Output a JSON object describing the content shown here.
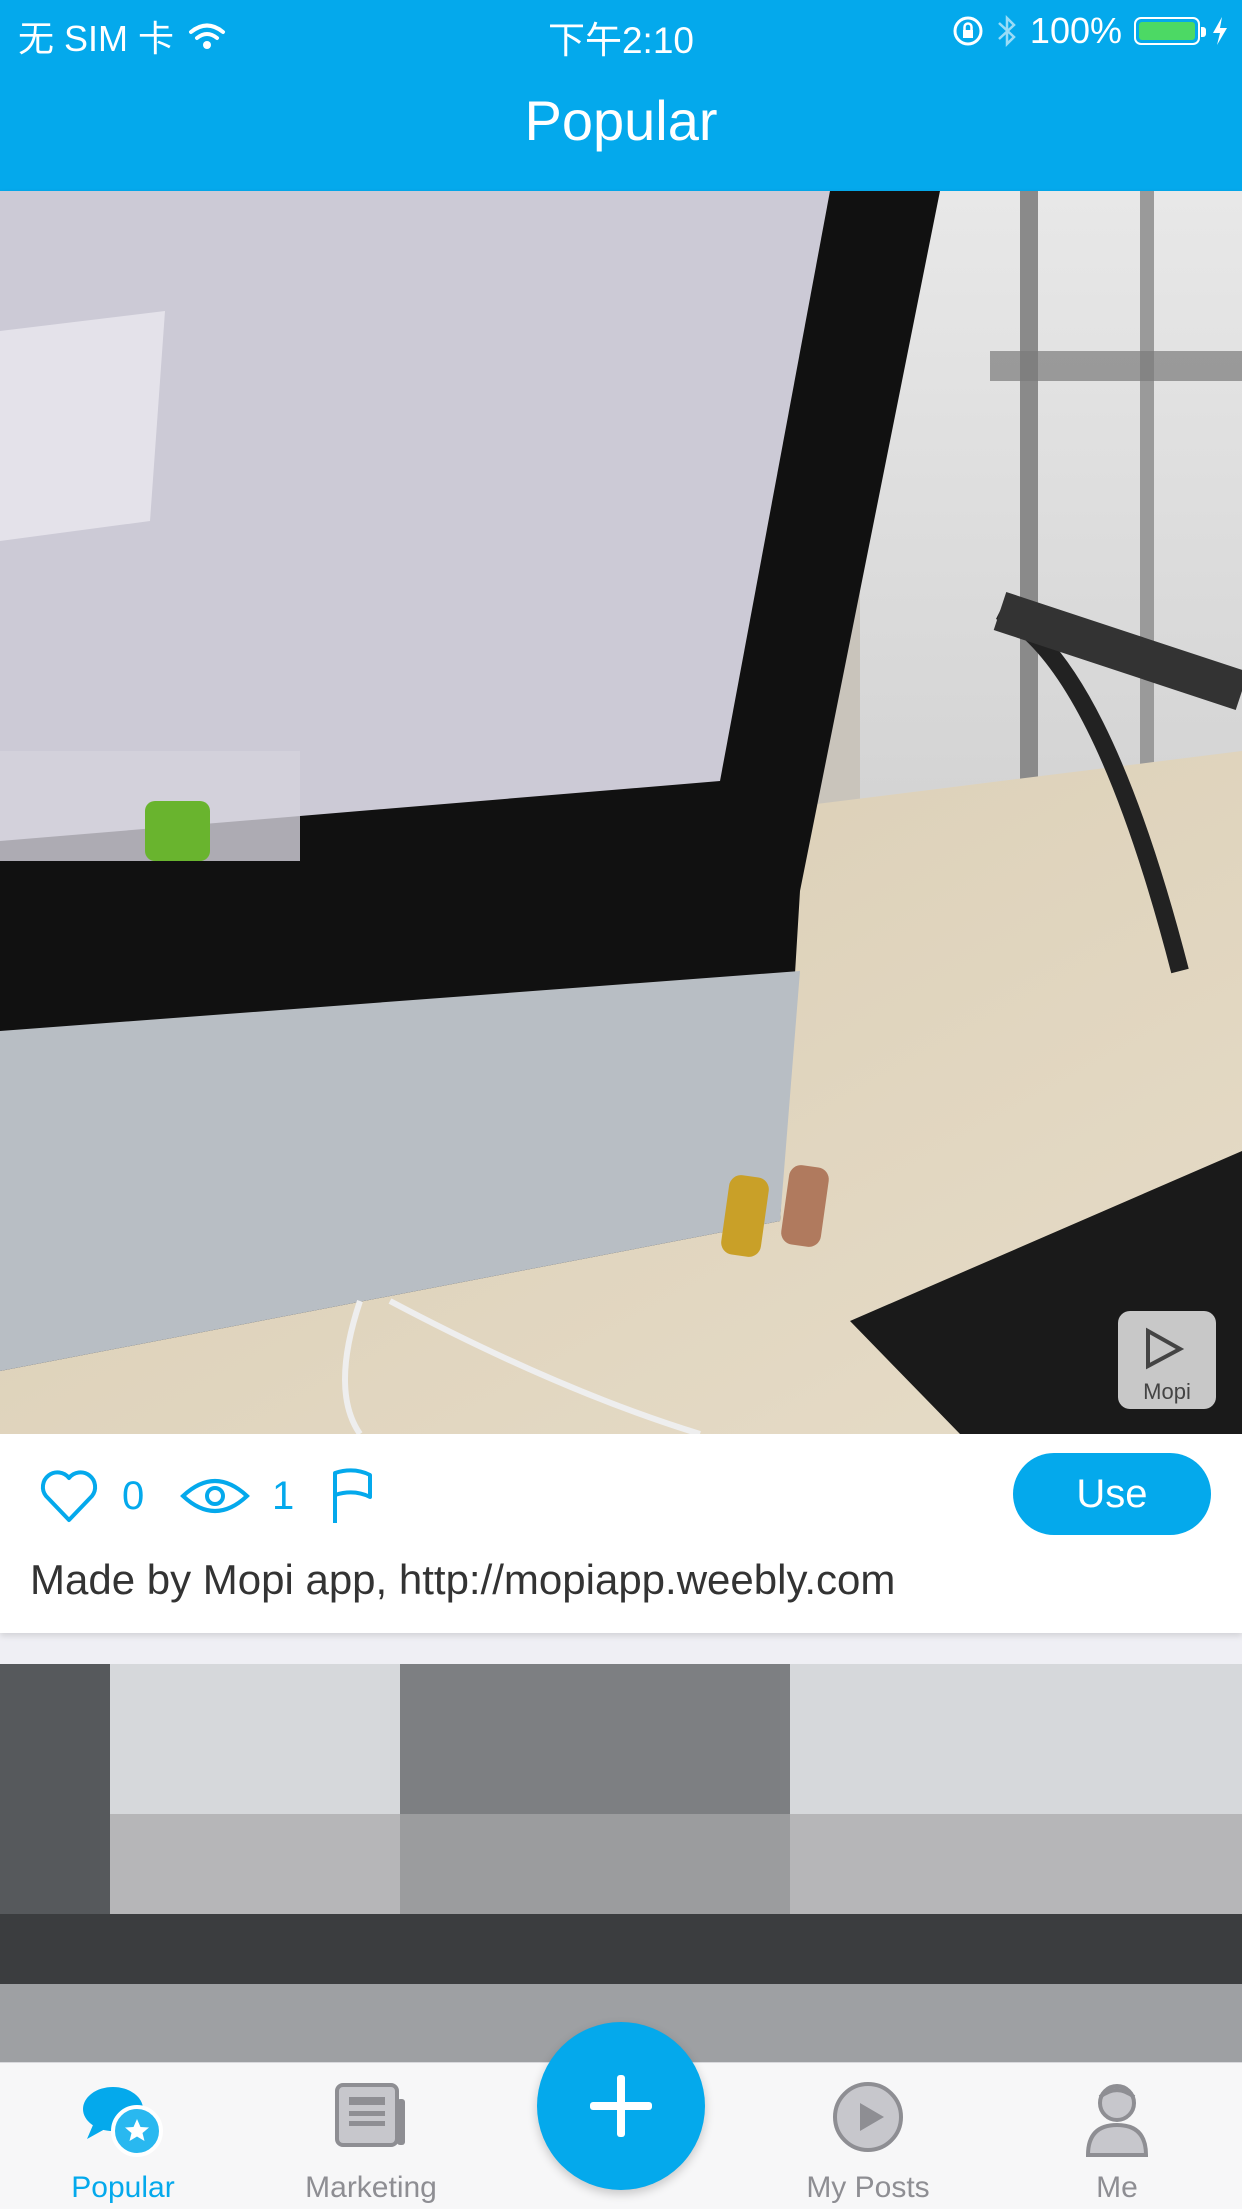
{
  "status": {
    "carrier": "无 SIM 卡",
    "time": "下午2:10",
    "battery_pct": "100%"
  },
  "nav": {
    "title": "Popular"
  },
  "posts": [
    {
      "likes": "0",
      "views": "1",
      "use_label": "Use",
      "description": "Made by Mopi app, http://mopiapp.weebly.com",
      "watermark": "Mopi"
    }
  ],
  "tabs": [
    {
      "label": "Popular",
      "icon": "chat-bubbles-star-icon",
      "active": true
    },
    {
      "label": "Marketing",
      "icon": "newspaper-icon",
      "active": false
    },
    {
      "label": "My Posts",
      "icon": "play-circle-icon",
      "active": false
    },
    {
      "label": "Me",
      "icon": "person-icon",
      "active": false
    }
  ],
  "fab": {
    "icon": "plus-icon"
  },
  "colors": {
    "accent": "#04a9ec",
    "inactive": "#8e8e93"
  }
}
